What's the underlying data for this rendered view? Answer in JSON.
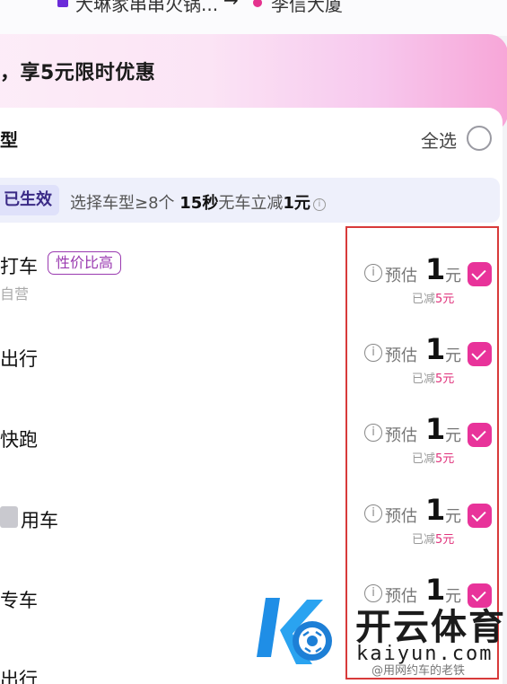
{
  "route": {
    "from": "大琳家串串火锅...",
    "arrow": "→",
    "to": "李信大厦"
  },
  "banner": {
    "title": "，享5元限时优惠"
  },
  "section": {
    "title": "型",
    "select_all_label": "全选"
  },
  "promo_strip": {
    "badge": "已生效",
    "text_prefix": "选择车型≥8个 ",
    "text_bold1": "15秒",
    "text_mid": "无车立减",
    "text_bold2": "1元",
    "info": "i"
  },
  "rows": [
    {
      "name": "打车",
      "tag": "性价比高",
      "sub": "自营",
      "price_label": "预估",
      "price_value": "1",
      "price_unit": "元",
      "saved": "已减",
      "saved_amount": "5元",
      "checked": true
    },
    {
      "name": "出行",
      "price_label": "预估",
      "price_value": "1",
      "price_unit": "元",
      "saved": "已减",
      "saved_amount": "5元",
      "checked": true
    },
    {
      "name": "快跑",
      "price_label": "预估",
      "price_value": "1",
      "price_unit": "元",
      "saved": "已减",
      "saved_amount": "5元",
      "checked": true
    },
    {
      "name": "用车",
      "price_label": "预估",
      "price_value": "1",
      "price_unit": "元",
      "saved": "已减",
      "saved_amount": "5元",
      "checked": true
    },
    {
      "name": "专车",
      "price_label": "预估",
      "price_value": "1",
      "price_unit": "元",
      "checked": true
    },
    {
      "name": "出行"
    }
  ],
  "watermark": {
    "brand_cn": "开云体育",
    "brand_en": "kaiyun.com",
    "caption": "@用网约车的老铁"
  },
  "colors": {
    "accent": "#e8339a",
    "highlight": "#d83a3a",
    "tag": "#9a3ab0"
  },
  "icons": {
    "info": "info-circle-icon",
    "check": "check-icon"
  }
}
